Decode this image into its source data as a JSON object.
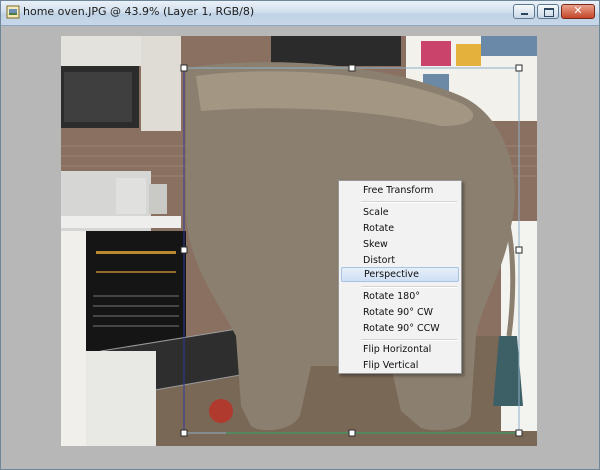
{
  "window": {
    "title": "home oven.JPG @ 43.9% (Layer 1, RGB/8)",
    "buttons": {
      "minimize": "minimize",
      "maximize": "maximize",
      "close": "✕"
    }
  },
  "context_menu": {
    "items": [
      {
        "label": "Free Transform",
        "active": false
      },
      {
        "label": "Scale",
        "active": false
      },
      {
        "label": "Rotate",
        "active": false
      },
      {
        "label": "Skew",
        "active": false
      },
      {
        "label": "Distort",
        "active": false
      },
      {
        "label": "Perspective",
        "active": true
      },
      {
        "label": "Rotate 180°",
        "active": false
      },
      {
        "label": "Rotate 90° CW",
        "active": false
      },
      {
        "label": "Rotate 90° CCW",
        "active": false
      },
      {
        "label": "Flip Horizontal",
        "active": false
      },
      {
        "label": "Flip Vertical",
        "active": false
      }
    ]
  },
  "colors": {
    "titlebar": "#cfdded",
    "menu_bg": "#f2f2f2",
    "menu_highlight": "#cfe0f4",
    "transform_box": "#8fb0c8",
    "handle": "#2a2a2a"
  }
}
